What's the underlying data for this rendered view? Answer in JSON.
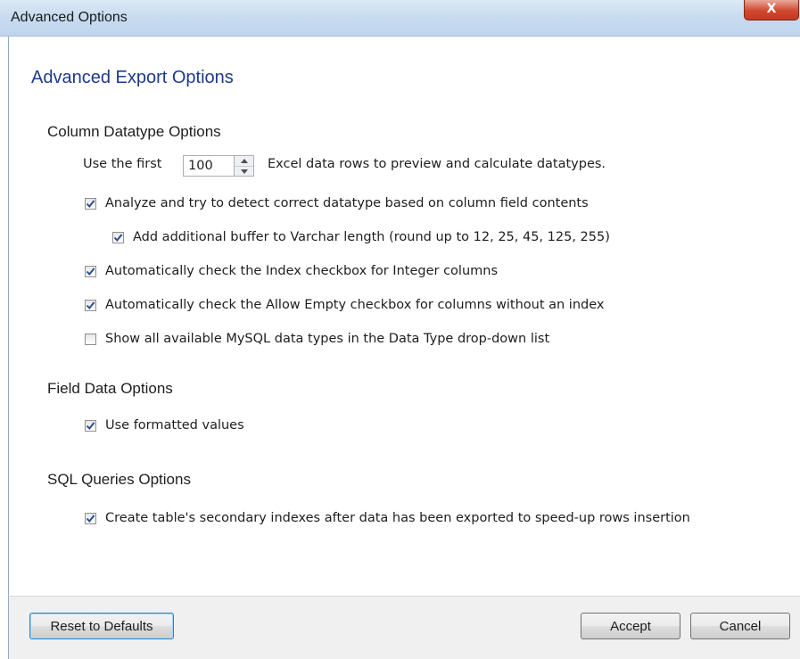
{
  "window": {
    "title": "Advanced Options",
    "close_label": "X"
  },
  "heading": "Advanced Export Options",
  "column_options": {
    "title": "Column Datatype Options",
    "preview": {
      "prefix": "Use the first",
      "value": "100",
      "suffix": "Excel data rows to preview and calculate datatypes."
    },
    "analyze": {
      "label": "Analyze and try to detect correct datatype based on column field contents",
      "checked": true
    },
    "buffer": {
      "label": "Add additional buffer to Varchar length (round up to 12, 25, 45, 125, 255)",
      "checked": true
    },
    "index_check": {
      "label": "Automatically check the Index checkbox for Integer columns",
      "checked": true
    },
    "allow_empty": {
      "label": "Automatically check the Allow Empty checkbox for columns without an index",
      "checked": true
    },
    "show_all_types": {
      "label": "Show all available MySQL data types in the Data Type drop-down list",
      "checked": false
    }
  },
  "field_options": {
    "title": "Field Data Options",
    "formatted": {
      "label": "Use formatted values",
      "checked": true
    }
  },
  "sql_options": {
    "title": "SQL Queries Options",
    "secondary_indexes": {
      "label": "Create table's secondary indexes after data has been exported to speed-up rows insertion",
      "checked": true
    }
  },
  "buttons": {
    "reset": "Reset to Defaults",
    "accept": "Accept",
    "cancel": "Cancel"
  },
  "colors": {
    "heading": "#1e3a8c",
    "checkmark": "#2a4e94",
    "close_button": "#d2472f",
    "default_button_border": "#3c7fb1"
  }
}
